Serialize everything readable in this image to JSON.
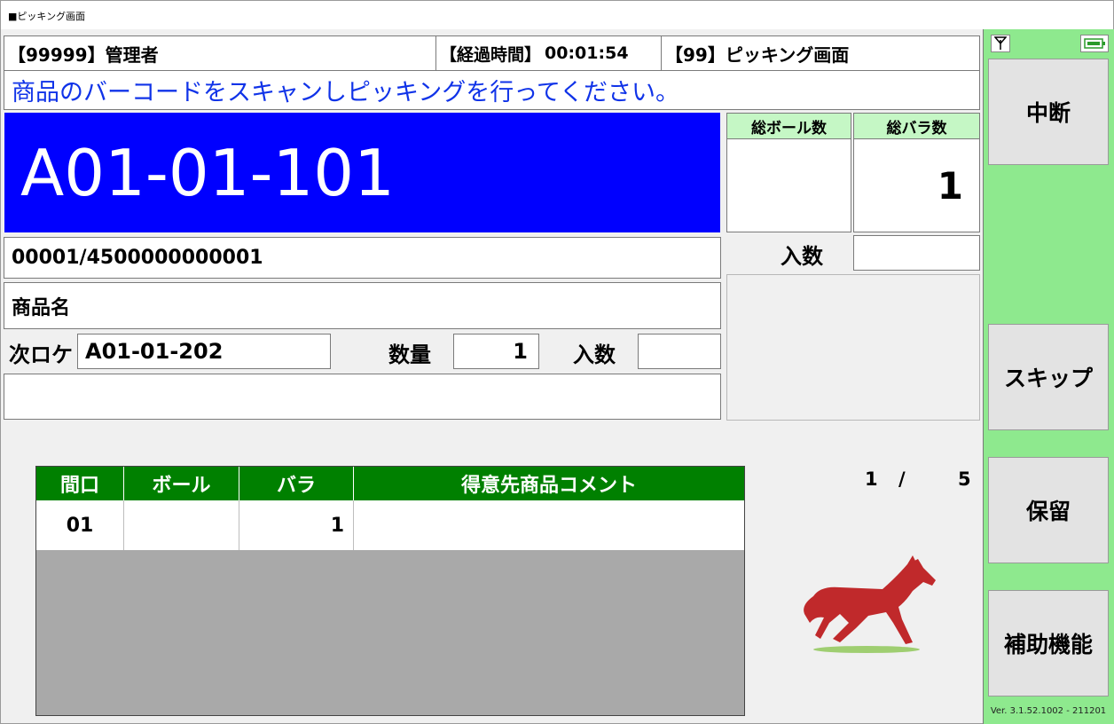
{
  "window": {
    "title": "■ピッキング画面"
  },
  "header": {
    "user": "【99999】管理者",
    "elapsed_label": "【経過時間】",
    "elapsed_value": "00:01:54",
    "screen": "【99】ピッキング画面"
  },
  "instruction": "商品のバーコードをスキャンしピッキングを行ってください。",
  "location": "A01-01-101",
  "totals": {
    "ball_label": "総ボール数",
    "ball_value": "",
    "bara_label": "総バラ数",
    "bara_value": "1",
    "irisu_label": "入数",
    "irisu_value": ""
  },
  "item": {
    "code": "00001/4500000000001",
    "name": "商品名",
    "next_loc_label": "次ロケ",
    "next_loc_value": "A01-01-202",
    "qty_label": "数量",
    "qty_value": "1",
    "irisu_label": "入数",
    "irisu_value": "",
    "comment": ""
  },
  "table": {
    "headers": [
      "間口",
      "ボール",
      "バラ",
      "得意先商品コメント"
    ],
    "rows": [
      {
        "maguchi": "01",
        "ball": "",
        "bara": "1",
        "comment": ""
      }
    ]
  },
  "pager": {
    "current": "1",
    "separator": "/",
    "total": "5"
  },
  "sidebar": {
    "interrupt": "中断",
    "skip": "スキップ",
    "hold": "保留",
    "assist": "補助機能",
    "version": "Ver. 3.1.52.1002 - 211201"
  },
  "icons": {
    "signal": "antenna-icon",
    "battery": "battery-plug-icon",
    "mascot": "horse-icon"
  },
  "colors": {
    "location_bg": "#0000ff",
    "table_header": "#008000",
    "sidebar": "#8ee98e",
    "instruction": "#1033e8"
  }
}
